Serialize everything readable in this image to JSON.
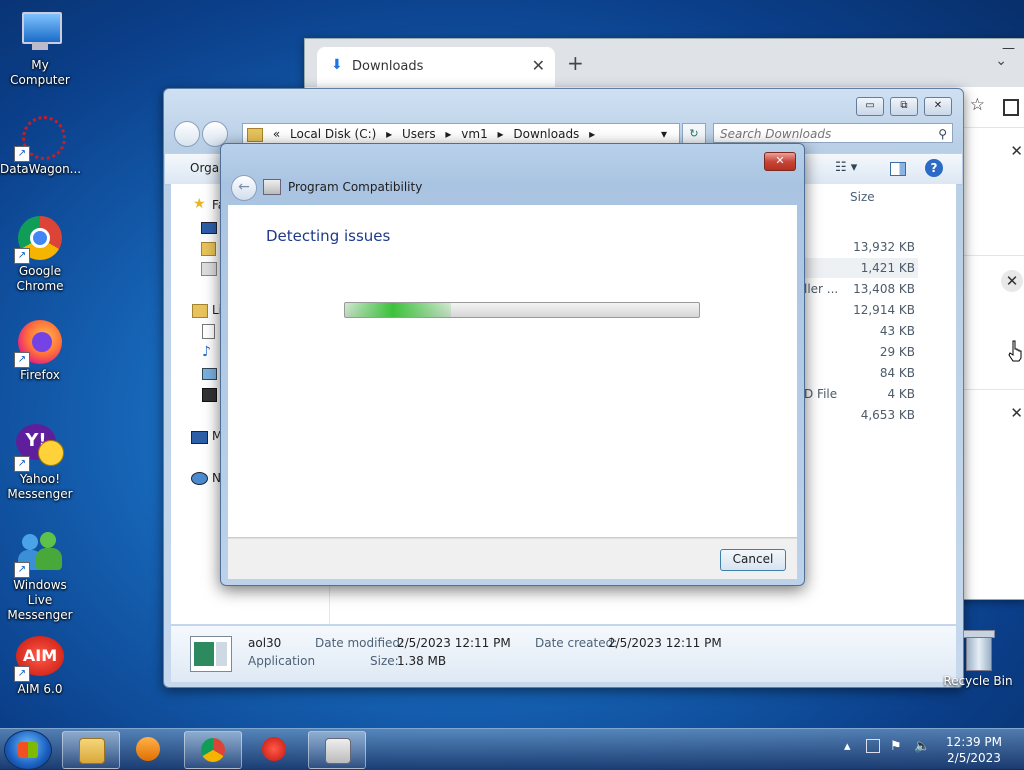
{
  "desktop": {
    "icons": [
      {
        "label": "My Computer"
      },
      {
        "label": "DataWagon..."
      },
      {
        "label": "Google Chrome"
      },
      {
        "label": "Firefox"
      },
      {
        "label": "Yahoo! Messenger"
      },
      {
        "label": "Windows Live Messenger"
      },
      {
        "label": "AIM 6.0"
      }
    ],
    "recycle_bin": "Recycle Bin"
  },
  "chrome": {
    "tab_title": "Downloads",
    "tab_close": "✕",
    "new_tab": "+",
    "minimize": "—",
    "chevron": "⌄",
    "star": "☆",
    "download_close": "✕"
  },
  "explorer": {
    "buttons": {
      "minimize": "▭",
      "restore": "⧉",
      "close": "✕"
    },
    "address": {
      "prefix": "«",
      "crumbs": [
        "Local Disk (C:)",
        "Users",
        "vm1",
        "Downloads"
      ],
      "separator": "▸",
      "dropdown": "▾"
    },
    "refresh": "↻",
    "search_placeholder": "Search Downloads",
    "toolbar": {
      "organize": "Organ"
    },
    "nav": {
      "favorites": "Fa",
      "libraries": "Li",
      "computer": "M",
      "network": "N"
    },
    "column_size": "Size",
    "file_sizes": [
      "13,932 KB",
      "1,421 KB",
      "13,408 KB",
      "12,914 KB",
      "43 KB",
      "29 KB",
      "84 KB",
      "4 KB",
      "4,653 KB"
    ],
    "type_fragments": {
      "row3": "ller ...",
      "row8": "D File"
    },
    "details": {
      "name": "aol30",
      "type": "Application",
      "date_modified_label": "Date modified:",
      "date_modified": "2/5/2023 12:11 PM",
      "date_created_label": "Date created:",
      "date_created": "2/5/2023 12:11 PM",
      "size_label": "Size:",
      "size": "1.38 MB"
    }
  },
  "dialog": {
    "title": "Program Compatibility",
    "heading": "Detecting issues",
    "cancel": "Cancel",
    "close": "✕",
    "progress_fraction": 0.3
  },
  "taskbar": {
    "clock_time": "12:39 PM",
    "clock_date": "2/5/2023"
  }
}
